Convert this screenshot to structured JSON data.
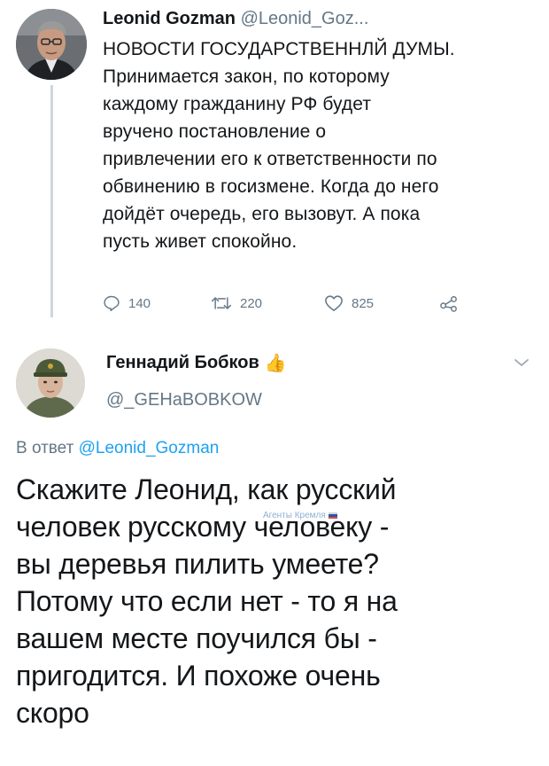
{
  "tweet1": {
    "author_name": "Leonid Gozman",
    "author_handle": "@Leonid_Goz...",
    "body_lines": [
      "НОВОСТИ ГОСУДАРСТВЕННЛЙ ДУМЫ.",
      "Принимается закон, по которому",
      "каждому гражданину РФ будет",
      "вручено постановление о",
      "привлечении его к ответственности по",
      "обвинению в госизмене. Когда до него",
      "дойдёт очередь, его вызовут. А пока",
      "пусть живет спокойно."
    ],
    "actions": {
      "reply_icon": "reply-icon",
      "reply_count": "140",
      "retweet_icon": "retweet-icon",
      "retweet_count": "220",
      "like_icon": "heart-icon",
      "like_count": "825",
      "share_icon": "share-icon"
    }
  },
  "tweet2": {
    "author_name": "Геннадий Бобков",
    "author_emoji": "👍",
    "author_handle": "@_GEHaBOBKOW",
    "reply_prefix": "В ответ",
    "reply_to": "@Leonid_Gozman",
    "body_lines": [
      "Скажите Леонид, как русский",
      "человек русскому человеку  -",
      "вы деревья пилить умеете?",
      "Потому что если нет - то я на",
      "вашем месте поучился бы -",
      "пригодится. И похоже очень",
      "скоро"
    ],
    "menu_icon": "chevron-down-icon"
  },
  "watermark": {
    "text": "Агенты Кремля",
    "flag_colors": [
      "#ffffff",
      "#0039a6",
      "#d52b1e"
    ]
  },
  "colors": {
    "text": "#14171a",
    "secondary": "#657786",
    "link": "#1da1f2",
    "thread_line": "#cfd6dc"
  }
}
